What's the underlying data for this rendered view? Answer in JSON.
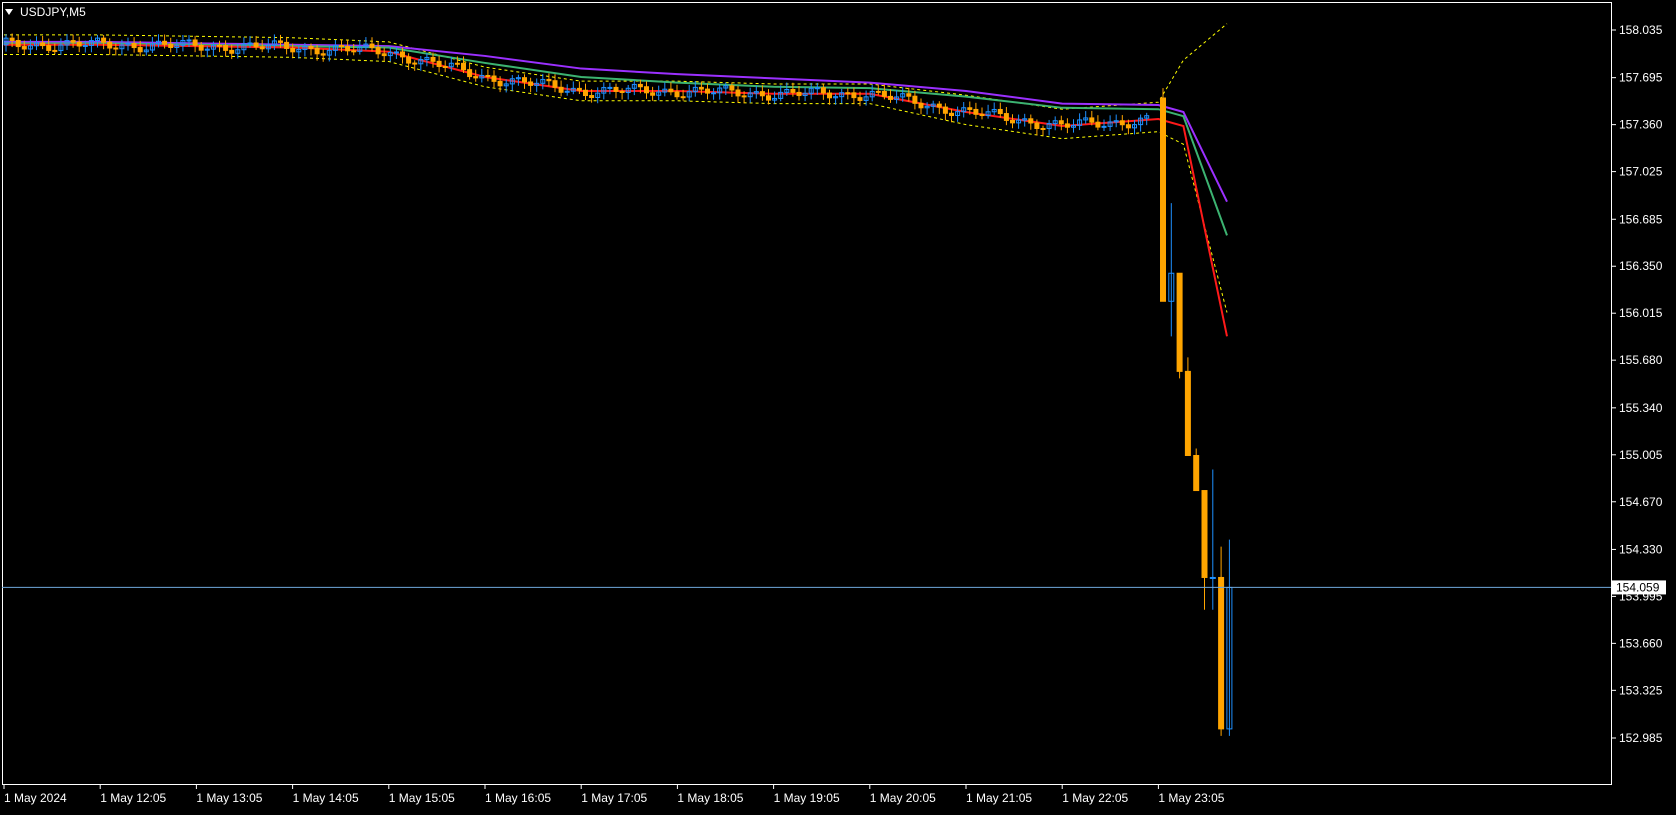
{
  "chart": {
    "title": "USDJPY,M5",
    "current_price_label": "154.059"
  },
  "colors": {
    "background": "#000000",
    "grid_frame": "#ffffff",
    "bull_candle": "#1e90ff",
    "bear_candle": "#ffa500",
    "ma_fast": "#ff1a1a",
    "ma_mid": "#3cb371",
    "ma_slow": "#9b30ff",
    "envelope": "#ffff00",
    "price_line": "#6fa8dc",
    "axis_text": "#ffffff"
  },
  "chart_data": {
    "type": "candlestick",
    "symbol": "USDJPY",
    "timeframe": "M5",
    "current_price": 154.059,
    "ylim": [
      152.985,
      158.035
    ],
    "y_ticks": [
      "158.035",
      "157.695",
      "157.360",
      "157.025",
      "156.685",
      "156.350",
      "156.015",
      "155.680",
      "155.340",
      "155.005",
      "154.670",
      "154.330",
      "153.995",
      "153.660",
      "153.325",
      "152.985"
    ],
    "x_ticks": [
      "1 May 2024",
      "1 May 12:05",
      "1 May 13:05",
      "1 May 14:05",
      "1 May 15:05",
      "1 May 16:05",
      "1 May 17:05",
      "1 May 18:05",
      "1 May 19:05",
      "1 May 20:05",
      "1 May 21:05",
      "1 May 22:05",
      "1 May 23:05"
    ],
    "grid": false,
    "envelope_right_end": {
      "upper": 158.08,
      "lower": 156.02
    },
    "notable_candles": [
      {
        "time": "1 May 23:00",
        "open": 157.55,
        "high": 157.62,
        "low": 156.1,
        "close": 156.1,
        "direction": "bear"
      },
      {
        "time": "1 May 23:05",
        "open": 156.1,
        "high": 156.8,
        "low": 155.85,
        "close": 156.3,
        "direction": "bull"
      },
      {
        "time": "1 May 23:10",
        "open": 156.3,
        "high": 156.3,
        "low": 155.55,
        "close": 155.6,
        "direction": "bear"
      },
      {
        "time": "1 May 23:15",
        "open": 155.6,
        "high": 155.7,
        "low": 155.0,
        "close": 155.0,
        "direction": "bear"
      },
      {
        "time": "1 May 23:20",
        "open": 155.0,
        "high": 155.05,
        "low": 154.75,
        "close": 154.75,
        "direction": "bear"
      },
      {
        "time": "1 May 23:25",
        "open": 154.75,
        "high": 154.75,
        "low": 153.9,
        "close": 154.13,
        "direction": "bear"
      },
      {
        "time": "1 May 23:30",
        "open": 154.13,
        "high": 154.9,
        "low": 153.9,
        "close": 154.13,
        "direction": "bear"
      },
      {
        "time": "1 May 23:35",
        "open": 154.13,
        "high": 154.35,
        "low": 153.0,
        "close": 153.05,
        "direction": "bear"
      },
      {
        "time": "1 May 23:40",
        "open": 153.05,
        "high": 154.4,
        "low": 153.0,
        "close": 154.059,
        "direction": "bull"
      }
    ],
    "series": [
      {
        "color": "#ff1a1a",
        "values_at_x_ticks": [
          157.93,
          157.93,
          157.92,
          157.91,
          157.88,
          157.7,
          157.6,
          157.6,
          157.58,
          157.58,
          157.45,
          157.35,
          157.4
        ],
        "end_value": 155.85
      },
      {
        "color": "#3cb371",
        "values_at_x_ticks": [
          157.94,
          157.94,
          157.93,
          157.92,
          157.91,
          157.8,
          157.7,
          157.66,
          157.63,
          157.62,
          157.56,
          157.48,
          157.47
        ],
        "end_value": 156.57
      },
      {
        "color": "#9b30ff",
        "values_at_x_ticks": [
          157.95,
          157.95,
          157.94,
          157.93,
          157.92,
          157.85,
          157.76,
          157.72,
          157.69,
          157.66,
          157.6,
          157.51,
          157.5
        ],
        "end_value": 156.81
      }
    ]
  }
}
